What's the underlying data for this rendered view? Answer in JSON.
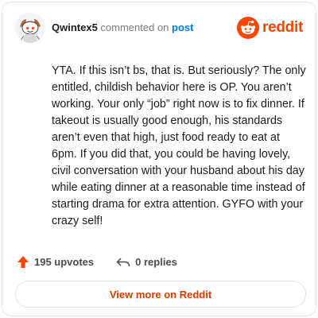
{
  "header": {
    "username": "Qwintex5",
    "action_text": "commented on",
    "post_link": "post",
    "brand": "reddit"
  },
  "comment": {
    "text": "YTA. If this isn’t bs, that is. But seriously? The only entitled, childish behavior here is OP. You aren’t working. Your only “job” right now is to fix dinner. If takeout is usually good enough, his standards aren’t even that high, just food ready to eat at 6pm. If you did that, you could be having lovely, civil conversation with your husband about his day while eating dinner at a reasonable time instead of starting drama for extra attention. GYFO with your crazy self!"
  },
  "actions": {
    "upvotes": "195 upvotes",
    "replies": "0 replies"
  },
  "footer": {
    "view_more": "View more on Reddit"
  },
  "colors": {
    "brand": "#ff4500",
    "link": "#0079d3",
    "upvote": "#ff4500",
    "view_more": "#d93a00"
  },
  "icons": {
    "avatar": "avatar-icon",
    "logo": "reddit-logo-icon",
    "upvote": "upvote-arrow-icon",
    "reply": "reply-arrow-icon"
  }
}
